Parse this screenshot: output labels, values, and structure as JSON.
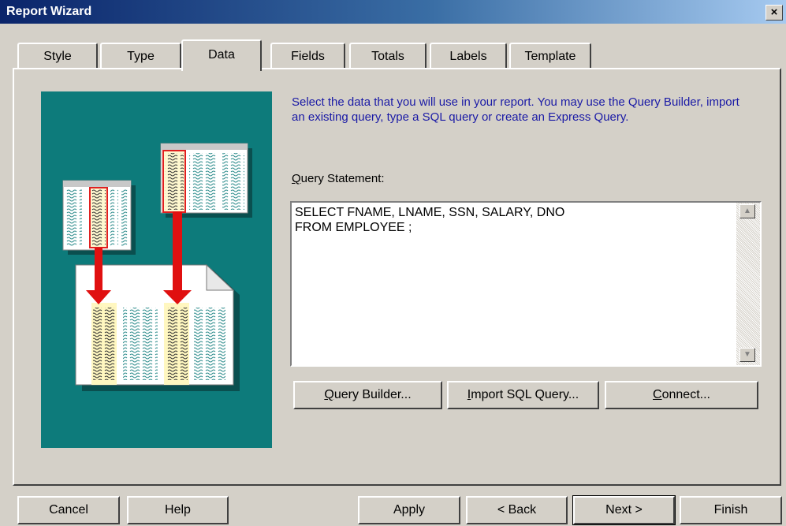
{
  "window": {
    "title": "Report Wizard",
    "close_label": "×"
  },
  "tabs": [
    {
      "label": "Style"
    },
    {
      "label": "Type"
    },
    {
      "label": "Data"
    },
    {
      "label": "Fields"
    },
    {
      "label": "Totals"
    },
    {
      "label": "Labels"
    },
    {
      "label": "Template"
    }
  ],
  "active_tab": "Data",
  "instructions": "Select the data that you will use in your report. You may use the Query Builder, import an existing query, type a SQL query or create an Express Query.",
  "query": {
    "label_prefix": "",
    "label_access": "Q",
    "label_rest": "uery Statement:",
    "text": "SELECT FNAME, LNAME, SSN, SALARY, DNO\nFROM EMPLOYEE ;"
  },
  "query_buttons": {
    "builder_access": "Q",
    "builder_rest": "uery Builder...",
    "import_access": "I",
    "import_rest": "mport SQL Query...",
    "connect_access": "C",
    "connect_rest": "onnect..."
  },
  "footer": {
    "cancel": "Cancel",
    "help": "Help",
    "apply": "Apply",
    "back": "< Back",
    "next": "Next >",
    "finish": "Finish"
  },
  "colors": {
    "illustration_bg": "#0d7b7b",
    "instruction_text": "#1a1aa6",
    "arrow": "#e01010"
  },
  "icons": {
    "scroll_up": "▲",
    "scroll_down": "▼"
  }
}
